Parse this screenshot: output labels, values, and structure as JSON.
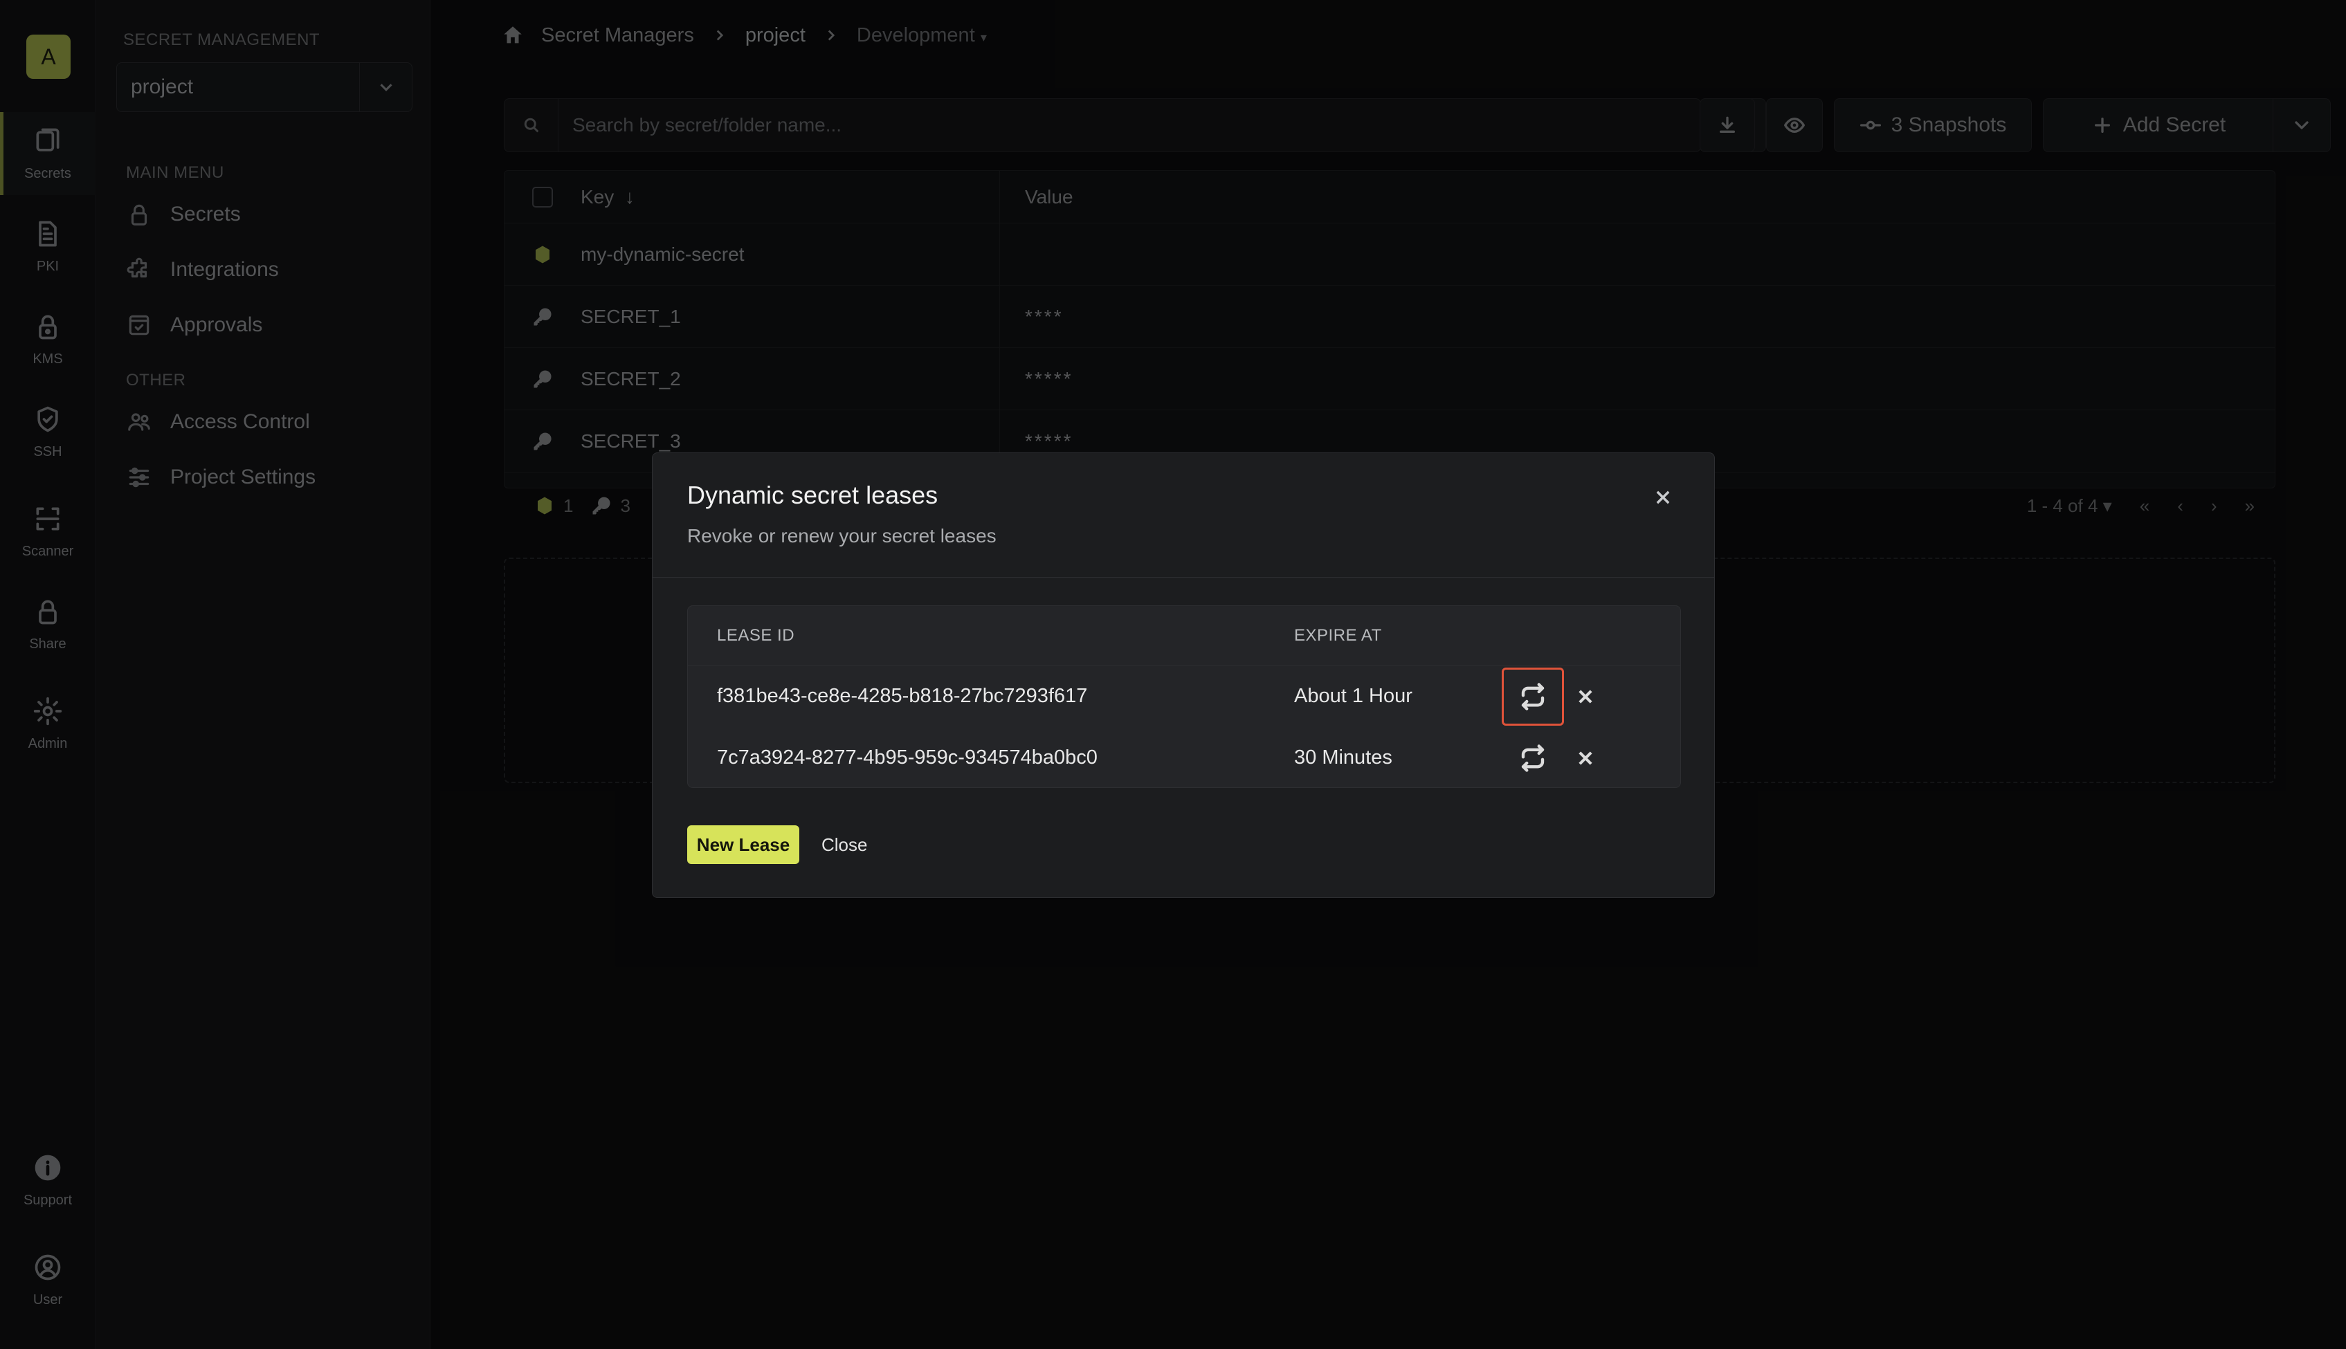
{
  "rail": {
    "avatar": "A",
    "items": [
      {
        "label": "Secrets",
        "icon": "secrets-icon",
        "active": true
      },
      {
        "label": "PKI",
        "icon": "document-icon"
      },
      {
        "label": "KMS",
        "icon": "lock-icon"
      },
      {
        "label": "SSH",
        "icon": "shield-icon"
      },
      {
        "label": "Scanner",
        "icon": "scan-icon"
      },
      {
        "label": "Share",
        "icon": "lock-icon"
      },
      {
        "label": "Admin",
        "icon": "gear-icon"
      },
      {
        "label": "Support",
        "icon": "info-icon"
      },
      {
        "label": "User",
        "icon": "user-icon"
      }
    ]
  },
  "sidebar": {
    "section_title": "SECRET MANAGEMENT",
    "project_value": "project",
    "main_menu_label": "MAIN MENU",
    "main_menu": [
      {
        "label": "Secrets",
        "icon": "lock-icon"
      },
      {
        "label": "Integrations",
        "icon": "puzzle-icon"
      },
      {
        "label": "Approvals",
        "icon": "checkbox-icon"
      }
    ],
    "other_label": "OTHER",
    "other_menu": [
      {
        "label": "Access Control",
        "icon": "users-icon"
      },
      {
        "label": "Project Settings",
        "icon": "sliders-icon"
      }
    ]
  },
  "breadcrumb": {
    "root": "Secret Managers",
    "project": "project",
    "environment": "Development"
  },
  "toolbar": {
    "search_placeholder": "Search by secret/folder name...",
    "snapshots_label": "3 Snapshots",
    "add_secret_label": "Add Secret"
  },
  "table": {
    "col_key": "Key",
    "col_value": "Value",
    "rows": [
      {
        "key": "my-dynamic-secret",
        "value": "",
        "type": "dynamic"
      },
      {
        "key": "SECRET_1",
        "value": "****",
        "type": "static"
      },
      {
        "key": "SECRET_2",
        "value": "*****",
        "type": "static"
      },
      {
        "key": "SECRET_3",
        "value": "*****",
        "type": "static"
      }
    ],
    "footer": {
      "dynamic_count": "1",
      "static_count": "3",
      "pagination": "1 - 4 of 4"
    }
  },
  "modal": {
    "title": "Dynamic secret leases",
    "subtitle": "Revoke or renew your secret leases",
    "col_lease_id": "LEASE ID",
    "col_expire_at": "EXPIRE AT",
    "leases": [
      {
        "id": "f381be43-ce8e-4285-b818-27bc7293f617",
        "expire": "About 1 Hour"
      },
      {
        "id": "7c7a3924-8277-4b95-959c-934574ba0bc0",
        "expire": "30 Minutes"
      }
    ],
    "new_lease_label": "New Lease",
    "close_label": "Close"
  },
  "colors": {
    "accent": "#d7e35a",
    "highlight": "#e0533a"
  }
}
